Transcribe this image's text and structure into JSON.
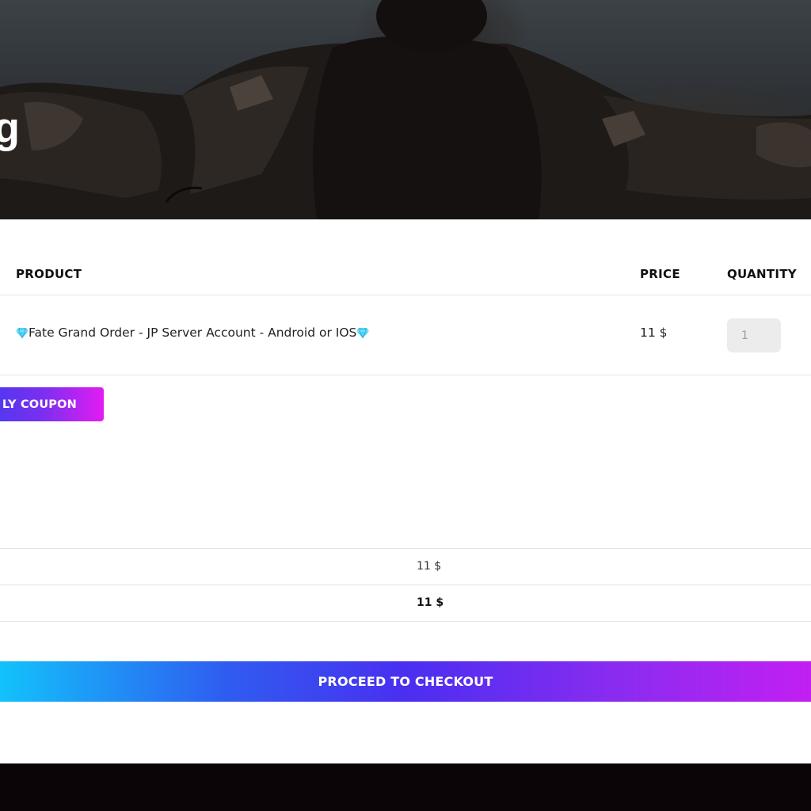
{
  "hero": {
    "title_fragment": "g"
  },
  "cart": {
    "columns": {
      "product": "PRODUCT",
      "price": "PRICE",
      "quantity": "QUANTITY"
    },
    "items": [
      {
        "name": "Fate Grand Order - JP Server Account - Android or IOS",
        "price": "11 $",
        "quantity": "1",
        "icon": "diamond-icon"
      }
    ],
    "coupon_button": "LY COUPON"
  },
  "totals": {
    "subtotal": "11 $",
    "total": "11 $"
  },
  "checkout": {
    "button_label": "PROCEED TO CHECKOUT"
  },
  "colors": {
    "accent_start": "#12c2fb",
    "accent_mid": "#4a2ff0",
    "accent_end": "#c21ff2",
    "footer_bg": "#0b0507",
    "gem_color": "#4fd3f5"
  }
}
